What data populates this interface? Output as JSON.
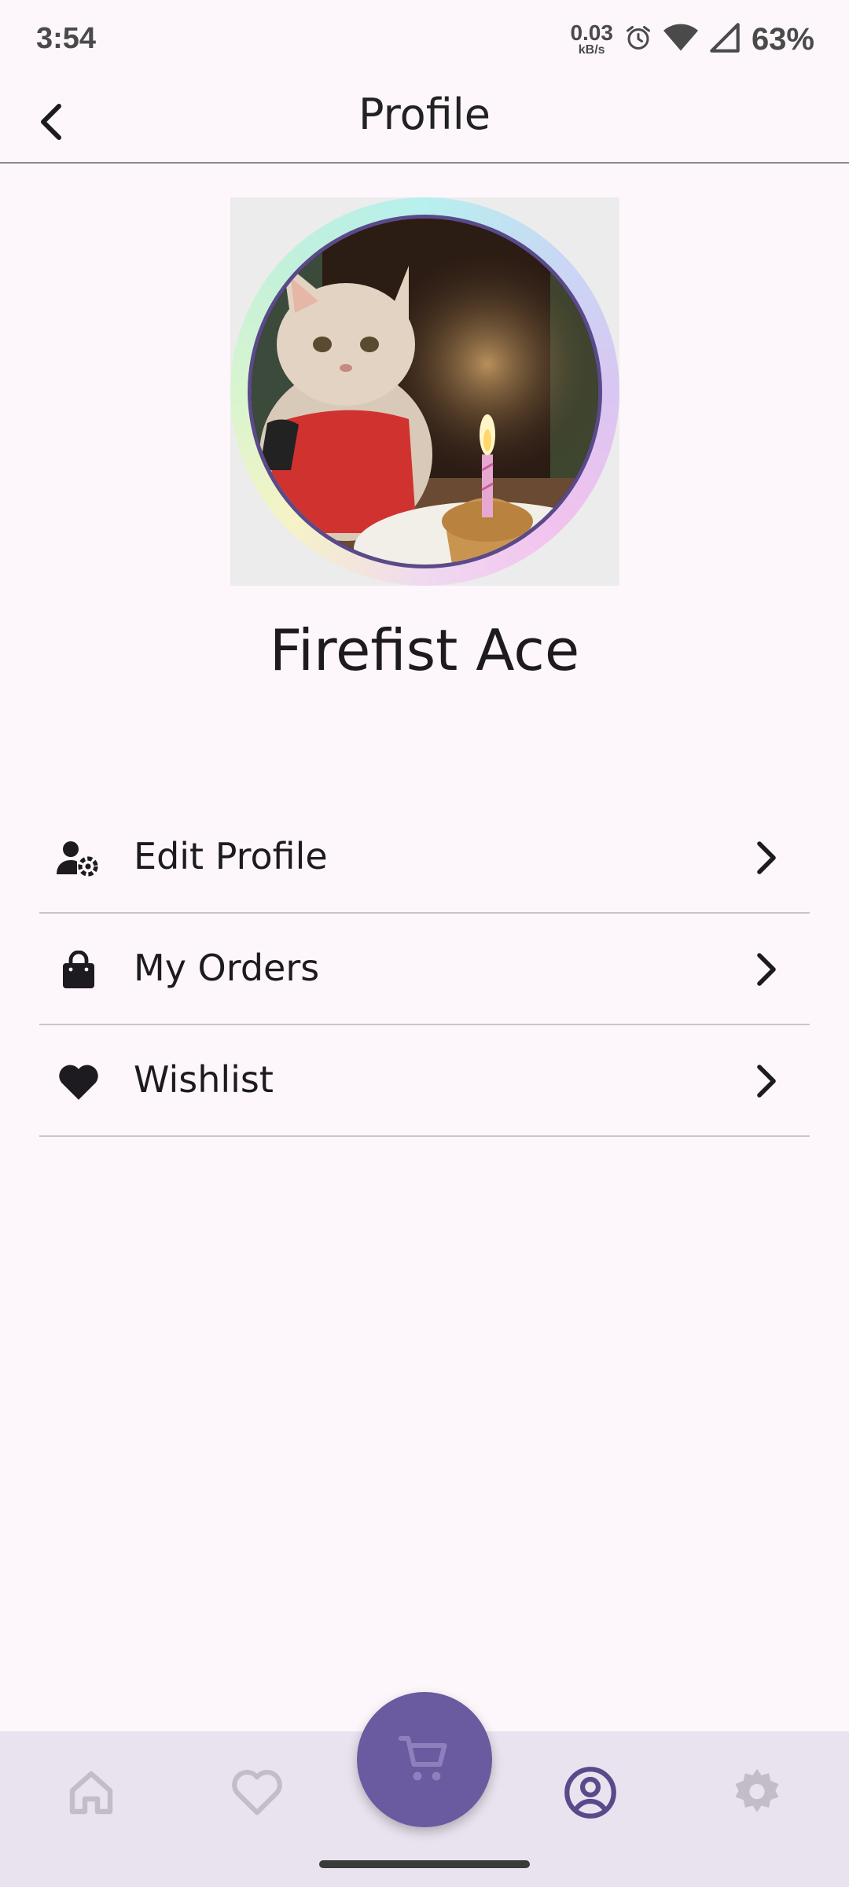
{
  "status_bar": {
    "time": "3:54",
    "net_speed_value": "0.03",
    "net_speed_unit": "kB/s",
    "battery": "63%",
    "icons": [
      "alarm-icon",
      "wifi-icon",
      "signal-icon"
    ]
  },
  "app_bar": {
    "title": "Profile",
    "back_icon": "back-arrow-icon"
  },
  "profile": {
    "name": "Firefist Ace",
    "avatar": "cat-with-cupcake-photo"
  },
  "menu": {
    "items": [
      {
        "label": "Edit Profile",
        "icon": "user-gear-icon"
      },
      {
        "label": "My Orders",
        "icon": "shopping-bag-icon"
      },
      {
        "label": "Wishlist",
        "icon": "heart-icon"
      }
    ]
  },
  "bottom_nav": {
    "items": [
      {
        "name": "home",
        "icon": "home-icon",
        "active": false
      },
      {
        "name": "wishlist",
        "icon": "heart-outline-icon",
        "active": false
      },
      {
        "name": "cart",
        "icon": "cart-icon",
        "active": false
      },
      {
        "name": "profile",
        "icon": "account-circle-icon",
        "active": true
      },
      {
        "name": "settings",
        "icon": "gear-icon",
        "active": false
      }
    ]
  },
  "colors": {
    "background": "#fdf7fc",
    "nav_background": "#e9e3ef",
    "accent": "#6a5a9f",
    "active_icon": "#5a4a8a",
    "inactive_icon": "#c4bcc9"
  }
}
